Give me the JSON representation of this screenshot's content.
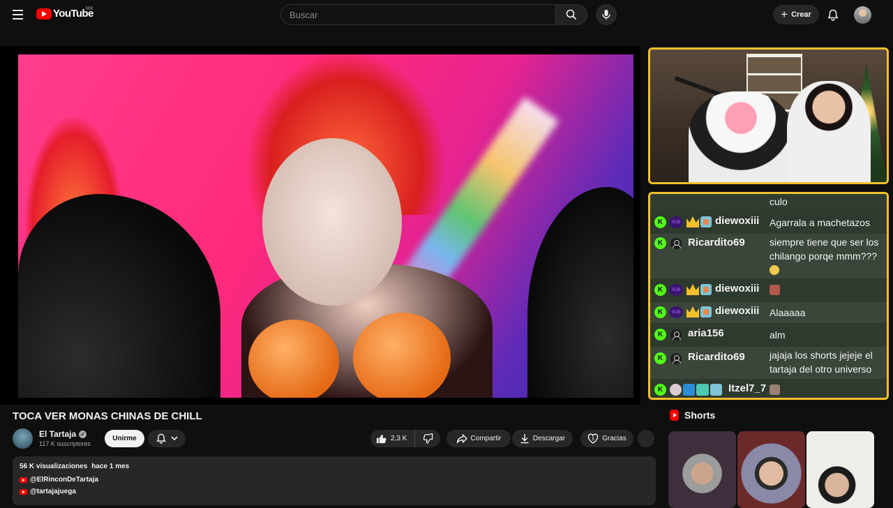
{
  "header": {
    "logo_text": "YouTube",
    "region": "MX",
    "search_placeholder": "Buscar",
    "create_label": "Crear"
  },
  "video": {
    "title": "TOCA VER MONAS CHINAS DE CHILL",
    "channel_name": "El Tartaja",
    "subscribers": "117 K suscriptores",
    "join_label": "Unirme",
    "like_count": "2,3 K",
    "share_label": "Compartir",
    "download_label": "Descargar",
    "thanks_label": "Gracias"
  },
  "description": {
    "views": "56 K visualizaciones",
    "date": "hace 1 mes",
    "links": [
      "@ElRinconDeTartaja",
      "@tartajajuega"
    ]
  },
  "chat": {
    "top_message": "culo",
    "messages": [
      {
        "user": "diewoxiii",
        "text": "Agarrala a machetazos"
      },
      {
        "user": "Ricardito69",
        "text": "siempre tiene que ser los chilango porqe mmm???"
      },
      {
        "user": "diewoxiii",
        "text": ""
      },
      {
        "user": "diewoxiii",
        "text": "Alaaaaa"
      },
      {
        "user": "aria156",
        "text": "alm"
      },
      {
        "user": "Ricardito69",
        "text": "jajaja los shorts jejeje el tartaja del otro universo"
      },
      {
        "user": "Itzel7_7",
        "text": ""
      }
    ],
    "badge_letter": "K"
  },
  "shorts": {
    "heading": "Shorts"
  },
  "colors": {
    "accent_border": "#f4c02b",
    "kick_green": "#53fc18",
    "youtube_red": "#ff0000"
  },
  "icons": [
    "menu-icon",
    "search-icon",
    "mic-icon",
    "bell-icon",
    "like-icon",
    "dislike-icon",
    "share-icon",
    "download-icon",
    "thanks-icon",
    "shorts-icon"
  ]
}
